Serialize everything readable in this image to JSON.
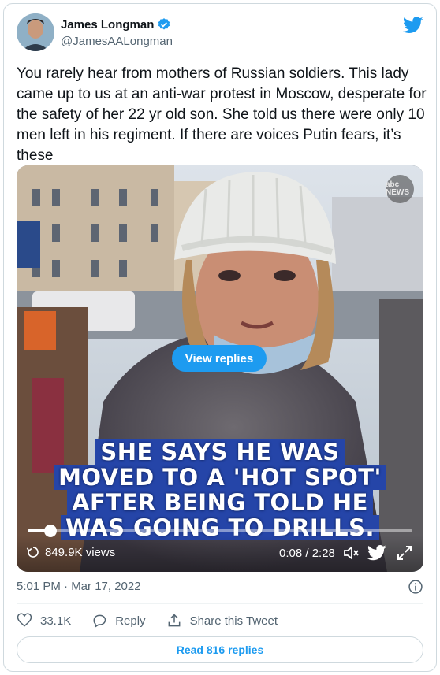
{
  "author": {
    "name": "James Longman",
    "handle": "@JamesAALongman",
    "verified": true
  },
  "tweet": {
    "text": "You rarely hear from mothers of Russian soldiers. This lady came up to us at an anti-war protest in Moscow, desperate for the safety of her 22 yr old son. She told us there were only 10 men left in his regiment. If there are voices Putin fears, it’s these",
    "timestamp": "5:01 PM · Mar 17, 2022"
  },
  "video": {
    "watermark": "abc NEWS",
    "view_replies_label": "View replies",
    "captions": [
      "SHE SAYS HE WAS",
      "MOVED TO A 'HOT SPOT'",
      "AFTER BEING TOLD HE",
      "WAS GOING TO DRILLS."
    ],
    "views": "849.9K views",
    "time": "0:08 / 2:28",
    "progress_fraction": 0.06
  },
  "actions": {
    "likes": "33.1K",
    "reply_label": "Reply",
    "share_label": "Share this Tweet"
  },
  "read_replies_label": "Read 816 replies",
  "colors": {
    "accent": "#1d9bf0",
    "caption_bg": "#2545a8",
    "secondary_text": "#536471"
  },
  "icons": [
    "verified-badge-icon",
    "twitter-bird-icon",
    "repeat-icon",
    "volume-icon",
    "fullscreen-icon",
    "info-icon",
    "heart-icon",
    "reply-icon",
    "share-icon"
  ]
}
